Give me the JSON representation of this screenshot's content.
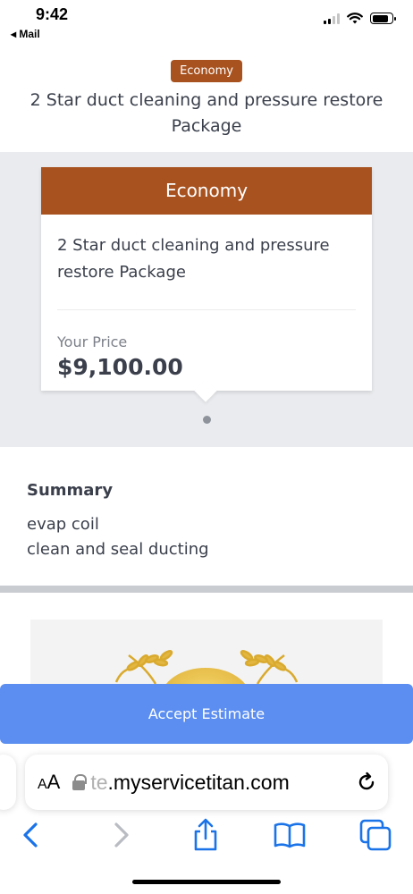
{
  "status_bar": {
    "time": "9:42",
    "back_label": "◂ Mail"
  },
  "header": {
    "badge": "Economy",
    "title": "2 Star duct cleaning and pressure restore Package"
  },
  "option_card": {
    "tier": "Economy",
    "description": "2 Star duct cleaning and pressure restore Package",
    "price_label": "Your Price",
    "price": "$9,100.00"
  },
  "summary": {
    "title": "Summary",
    "lines": [
      "evap coil",
      "clean and seal ducting"
    ]
  },
  "accept_button": {
    "label": "Accept Estimate"
  },
  "browser": {
    "aa_small": "A",
    "aa_large": "A",
    "url_faded": "te",
    "url": ".myservicetitan.com"
  },
  "colors": {
    "accent": "#a8521f",
    "button": "#5b8ef0",
    "ios_blue": "#1a73e8"
  }
}
